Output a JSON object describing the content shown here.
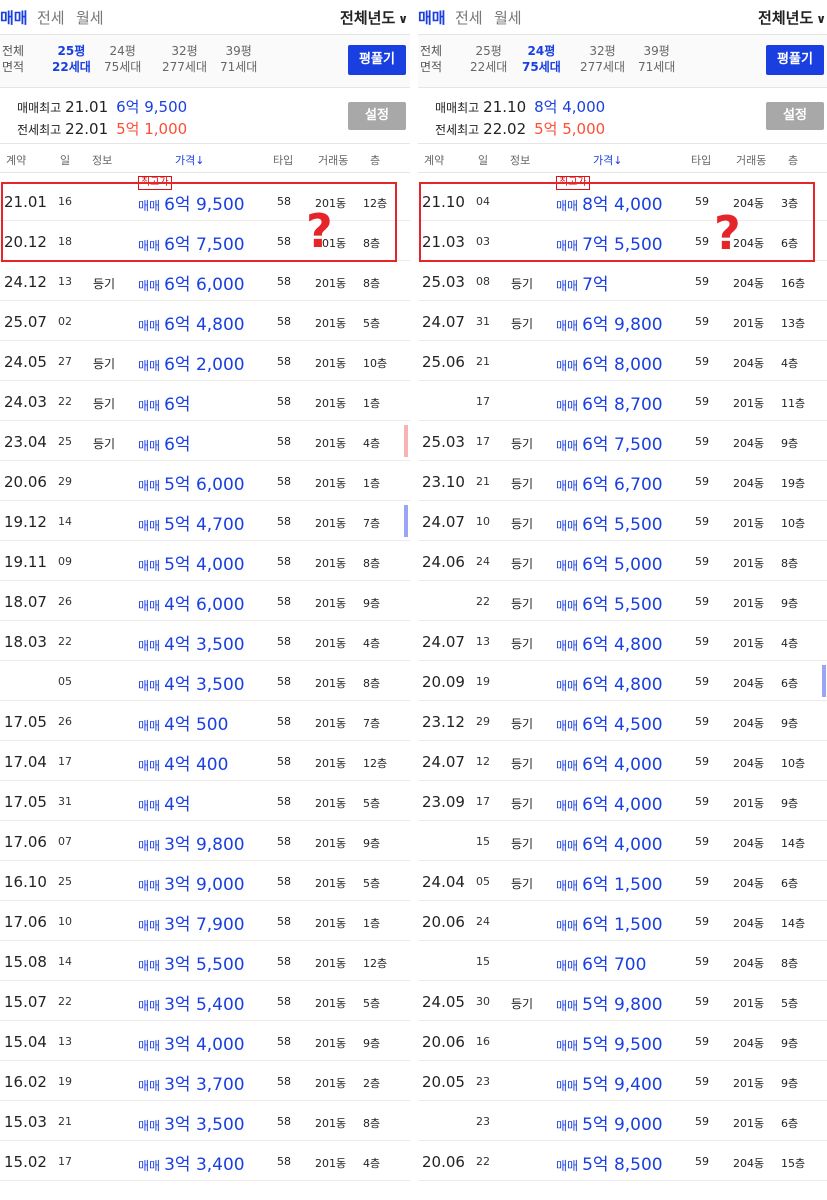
{
  "panels": [
    {
      "tabs": [
        "매매",
        "전세",
        "월세"
      ],
      "year_select": "전체년도",
      "area": {
        "label_top": "전체",
        "label_bottom": "면적",
        "options": [
          {
            "size": "25평",
            "households": "22세대",
            "selected": true
          },
          {
            "size": "24평",
            "households": "75세대",
            "selected": false
          },
          {
            "size": "32평",
            "households": "277세대",
            "selected": false
          },
          {
            "size": "39평",
            "households": "71세대",
            "selected": false
          }
        ]
      },
      "pyeong_button": "평풀기",
      "summary": {
        "trade_label": "매매최고",
        "trade_date": "21.01",
        "trade_price": "6억 9,500",
        "jeonse_label": "전세최고",
        "jeonse_date": "22.01",
        "jeonse_price": "5억 1,000"
      },
      "settings_button": "설정",
      "columns": {
        "contract": "계약",
        "day": "일",
        "info": "정보",
        "price": "가격↓",
        "type": "타입",
        "dong": "거래동",
        "floor": "층"
      },
      "badge": "최고가",
      "question_mark": "?",
      "rows": [
        {
          "date": "21.01",
          "day": "16",
          "info": "",
          "kind": "매매",
          "price": "6억 9,500",
          "type": "58",
          "dong": "201동",
          "floor": "12층"
        },
        {
          "date": "20.12",
          "day": "18",
          "info": "",
          "kind": "매매",
          "price": "6억 7,500",
          "type": "58",
          "dong": "201동",
          "floor": "8층"
        },
        {
          "date": "24.12",
          "day": "13",
          "info": "등기",
          "kind": "매매",
          "price": "6억 6,000",
          "type": "58",
          "dong": "201동",
          "floor": "8층"
        },
        {
          "date": "25.07",
          "day": "02",
          "info": "",
          "kind": "매매",
          "price": "6억 4,800",
          "type": "58",
          "dong": "201동",
          "floor": "5층"
        },
        {
          "date": "24.05",
          "day": "27",
          "info": "등기",
          "kind": "매매",
          "price": "6억 2,000",
          "type": "58",
          "dong": "201동",
          "floor": "10층"
        },
        {
          "date": "24.03",
          "day": "22",
          "info": "등기",
          "kind": "매매",
          "price": "6억",
          "type": "58",
          "dong": "201동",
          "floor": "1층"
        },
        {
          "date": "23.04",
          "day": "25",
          "info": "등기",
          "kind": "매매",
          "price": "6억",
          "type": "58",
          "dong": "201동",
          "floor": "4층"
        },
        {
          "date": "20.06",
          "day": "29",
          "info": "",
          "kind": "매매",
          "price": "5억 6,000",
          "type": "58",
          "dong": "201동",
          "floor": "1층"
        },
        {
          "date": "19.12",
          "day": "14",
          "info": "",
          "kind": "매매",
          "price": "5억 4,700",
          "type": "58",
          "dong": "201동",
          "floor": "7층"
        },
        {
          "date": "19.11",
          "day": "09",
          "info": "",
          "kind": "매매",
          "price": "5억 4,000",
          "type": "58",
          "dong": "201동",
          "floor": "8층"
        },
        {
          "date": "18.07",
          "day": "26",
          "info": "",
          "kind": "매매",
          "price": "4억 6,000",
          "type": "58",
          "dong": "201동",
          "floor": "9층"
        },
        {
          "date": "18.03",
          "day": "22",
          "info": "",
          "kind": "매매",
          "price": "4억 3,500",
          "type": "58",
          "dong": "201동",
          "floor": "4층"
        },
        {
          "date": "",
          "day": "05",
          "info": "",
          "kind": "매매",
          "price": "4억 3,500",
          "type": "58",
          "dong": "201동",
          "floor": "8층"
        },
        {
          "date": "17.05",
          "day": "26",
          "info": "",
          "kind": "매매",
          "price": "4억 500",
          "type": "58",
          "dong": "201동",
          "floor": "7층"
        },
        {
          "date": "17.04",
          "day": "17",
          "info": "",
          "kind": "매매",
          "price": "4억 400",
          "type": "58",
          "dong": "201동",
          "floor": "12층"
        },
        {
          "date": "17.05",
          "day": "31",
          "info": "",
          "kind": "매매",
          "price": "4억",
          "type": "58",
          "dong": "201동",
          "floor": "5층"
        },
        {
          "date": "17.06",
          "day": "07",
          "info": "",
          "kind": "매매",
          "price": "3억 9,800",
          "type": "58",
          "dong": "201동",
          "floor": "9층"
        },
        {
          "date": "16.10",
          "day": "25",
          "info": "",
          "kind": "매매",
          "price": "3억 9,000",
          "type": "58",
          "dong": "201동",
          "floor": "5층"
        },
        {
          "date": "17.06",
          "day": "10",
          "info": "",
          "kind": "매매",
          "price": "3억 7,900",
          "type": "58",
          "dong": "201동",
          "floor": "1층"
        },
        {
          "date": "15.08",
          "day": "14",
          "info": "",
          "kind": "매매",
          "price": "3억 5,500",
          "type": "58",
          "dong": "201동",
          "floor": "12층"
        },
        {
          "date": "15.07",
          "day": "22",
          "info": "",
          "kind": "매매",
          "price": "3억 5,400",
          "type": "58",
          "dong": "201동",
          "floor": "5층"
        },
        {
          "date": "15.04",
          "day": "13",
          "info": "",
          "kind": "매매",
          "price": "3억 4,000",
          "type": "58",
          "dong": "201동",
          "floor": "9층"
        },
        {
          "date": "16.02",
          "day": "19",
          "info": "",
          "kind": "매매",
          "price": "3억 3,700",
          "type": "58",
          "dong": "201동",
          "floor": "2층"
        },
        {
          "date": "15.03",
          "day": "21",
          "info": "",
          "kind": "매매",
          "price": "3억 3,500",
          "type": "58",
          "dong": "201동",
          "floor": "8층"
        },
        {
          "date": "15.02",
          "day": "17",
          "info": "",
          "kind": "매매",
          "price": "3억 3,400",
          "type": "58",
          "dong": "201동",
          "floor": "4층"
        }
      ]
    },
    {
      "tabs": [
        "매매",
        "전세",
        "월세"
      ],
      "year_select": "전체년도",
      "area": {
        "label_top": "전체",
        "label_bottom": "면적",
        "options": [
          {
            "size": "25평",
            "households": "22세대",
            "selected": false
          },
          {
            "size": "24평",
            "households": "75세대",
            "selected": true
          },
          {
            "size": "32평",
            "households": "277세대",
            "selected": false
          },
          {
            "size": "39평",
            "households": "71세대",
            "selected": false
          }
        ]
      },
      "pyeong_button": "평풀기",
      "summary": {
        "trade_label": "매매최고",
        "trade_date": "21.10",
        "trade_price": "8억 4,000",
        "jeonse_label": "전세최고",
        "jeonse_date": "22.02",
        "jeonse_price": "5억 5,000"
      },
      "settings_button": "설정",
      "columns": {
        "contract": "계약",
        "day": "일",
        "info": "정보",
        "price": "가격↓",
        "type": "타입",
        "dong": "거래동",
        "floor": "층"
      },
      "badge": "최고가",
      "question_mark": "?",
      "rows": [
        {
          "date": "21.10",
          "day": "04",
          "info": "",
          "kind": "매매",
          "price": "8억 4,000",
          "type": "59",
          "dong": "204동",
          "floor": "3층"
        },
        {
          "date": "21.03",
          "day": "03",
          "info": "",
          "kind": "매매",
          "price": "7억 5,500",
          "type": "59",
          "dong": "204동",
          "floor": "6층"
        },
        {
          "date": "25.03",
          "day": "08",
          "info": "등기",
          "kind": "매매",
          "price": "7억",
          "type": "59",
          "dong": "204동",
          "floor": "16층"
        },
        {
          "date": "24.07",
          "day": "31",
          "info": "등기",
          "kind": "매매",
          "price": "6억 9,800",
          "type": "59",
          "dong": "201동",
          "floor": "13층"
        },
        {
          "date": "25.06",
          "day": "21",
          "info": "",
          "kind": "매매",
          "price": "6억 8,000",
          "type": "59",
          "dong": "204동",
          "floor": "4층"
        },
        {
          "date": "",
          "day": "17",
          "info": "",
          "kind": "매매",
          "price": "6억 8,700",
          "type": "59",
          "dong": "201동",
          "floor": "11층"
        },
        {
          "date": "25.03",
          "day": "17",
          "info": "등기",
          "kind": "매매",
          "price": "6억 7,500",
          "type": "59",
          "dong": "204동",
          "floor": "9층"
        },
        {
          "date": "23.10",
          "day": "21",
          "info": "등기",
          "kind": "매매",
          "price": "6억 6,700",
          "type": "59",
          "dong": "204동",
          "floor": "19층"
        },
        {
          "date": "24.07",
          "day": "10",
          "info": "등기",
          "kind": "매매",
          "price": "6억 5,500",
          "type": "59",
          "dong": "201동",
          "floor": "10층"
        },
        {
          "date": "24.06",
          "day": "24",
          "info": "등기",
          "kind": "매매",
          "price": "6억 5,000",
          "type": "59",
          "dong": "201동",
          "floor": "8층"
        },
        {
          "date": "",
          "day": "22",
          "info": "등기",
          "kind": "매매",
          "price": "6억 5,500",
          "type": "59",
          "dong": "201동",
          "floor": "9층"
        },
        {
          "date": "24.07",
          "day": "13",
          "info": "등기",
          "kind": "매매",
          "price": "6억 4,800",
          "type": "59",
          "dong": "201동",
          "floor": "4층"
        },
        {
          "date": "20.09",
          "day": "19",
          "info": "",
          "kind": "매매",
          "price": "6억 4,800",
          "type": "59",
          "dong": "204동",
          "floor": "6층"
        },
        {
          "date": "23.12",
          "day": "29",
          "info": "등기",
          "kind": "매매",
          "price": "6억 4,500",
          "type": "59",
          "dong": "204동",
          "floor": "9층"
        },
        {
          "date": "24.07",
          "day": "12",
          "info": "등기",
          "kind": "매매",
          "price": "6억 4,000",
          "type": "59",
          "dong": "204동",
          "floor": "10층"
        },
        {
          "date": "23.09",
          "day": "17",
          "info": "등기",
          "kind": "매매",
          "price": "6억 4,000",
          "type": "59",
          "dong": "201동",
          "floor": "9층"
        },
        {
          "date": "",
          "day": "15",
          "info": "등기",
          "kind": "매매",
          "price": "6억 4,000",
          "type": "59",
          "dong": "204동",
          "floor": "14층"
        },
        {
          "date": "24.04",
          "day": "05",
          "info": "등기",
          "kind": "매매",
          "price": "6억 1,500",
          "type": "59",
          "dong": "204동",
          "floor": "6층"
        },
        {
          "date": "20.06",
          "day": "24",
          "info": "",
          "kind": "매매",
          "price": "6억 1,500",
          "type": "59",
          "dong": "204동",
          "floor": "14층"
        },
        {
          "date": "",
          "day": "15",
          "info": "",
          "kind": "매매",
          "price": "6억 700",
          "type": "59",
          "dong": "204동",
          "floor": "8층"
        },
        {
          "date": "24.05",
          "day": "30",
          "info": "등기",
          "kind": "매매",
          "price": "5억 9,800",
          "type": "59",
          "dong": "201동",
          "floor": "5층"
        },
        {
          "date": "20.06",
          "day": "16",
          "info": "",
          "kind": "매매",
          "price": "5억 9,500",
          "type": "59",
          "dong": "204동",
          "floor": "9층"
        },
        {
          "date": "20.05",
          "day": "23",
          "info": "",
          "kind": "매매",
          "price": "5억 9,400",
          "type": "59",
          "dong": "201동",
          "floor": "9층"
        },
        {
          "date": "",
          "day": "23",
          "info": "",
          "kind": "매매",
          "price": "5억 9,000",
          "type": "59",
          "dong": "201동",
          "floor": "6층"
        },
        {
          "date": "20.06",
          "day": "22",
          "info": "",
          "kind": "매매",
          "price": "5억 8,500",
          "type": "59",
          "dong": "204동",
          "floor": "15층"
        }
      ]
    }
  ],
  "colors": {
    "accent": "#1a3fe0",
    "red": "#ff4d36",
    "highlight": "#e5252a",
    "mark_pink": "#f8b4b4",
    "mark_blue": "#9aa6f5"
  }
}
